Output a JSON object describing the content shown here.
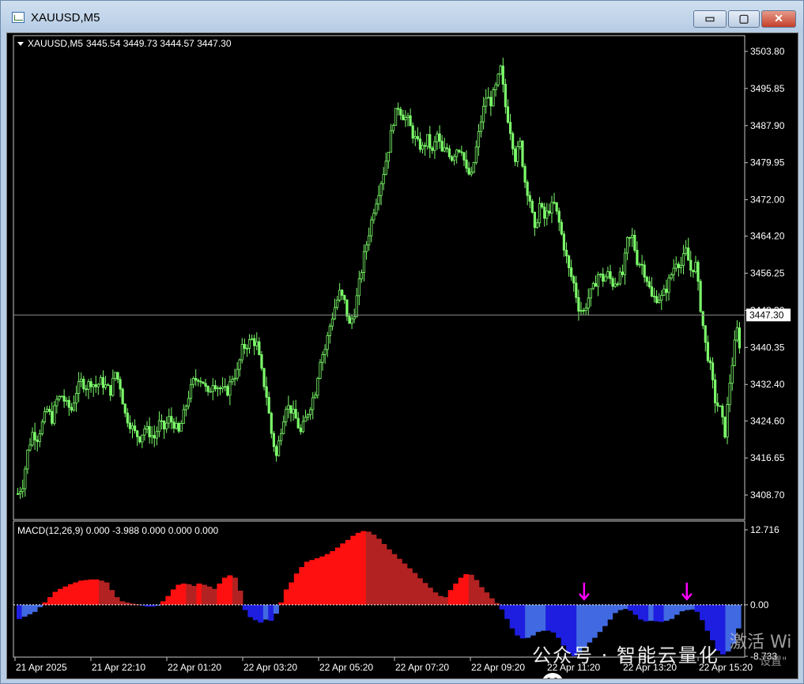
{
  "window": {
    "title": "XAUUSD,M5",
    "buttons": {
      "minimize": "▭",
      "maximize": "▢",
      "close": "✕"
    }
  },
  "price_panel": {
    "header_symbol": "XAUUSD,M5",
    "header_ohlc": "3445.54 3449.73 3444.57 3447.30",
    "y_ticks": [
      "3503.80",
      "3495.85",
      "3487.90",
      "3479.95",
      "3472.00",
      "3464.20",
      "3456.25",
      "3448.30",
      "3440.35",
      "3432.40",
      "3424.60",
      "3416.65",
      "3408.70"
    ],
    "current_price_label": "3447.30",
    "current_price": 3447.3
  },
  "macd_panel": {
    "header": "MACD(12,26,9) 0.000 -3.988 0.000 0.000 0.000",
    "y_ticks": [
      "12.716",
      "0.00",
      "-8.733"
    ]
  },
  "x_ticks": [
    "21 Apr 2025",
    "21 Apr 22:10",
    "22 Apr 01:20",
    "22 Apr 03:20",
    "22 Apr 05:20",
    "22 Apr 07:20",
    "22 Apr 09:20",
    "22 Apr 11:20",
    "22 Apr 13:20",
    "22 Apr 15:20"
  ],
  "overlay": {
    "watermark": "公众号 · 智能云量化",
    "activate": "激活 Wi",
    "activate_sub": "设置\""
  },
  "colors": {
    "candle": "#7cfc6a",
    "macd_red": "#ff1010",
    "macd_darkred": "#b22222",
    "macd_blue": "#1e1ee0",
    "macd_lightblue": "#4169e1",
    "arrow": "#ff00ff",
    "bg": "#000000"
  },
  "chart_data": {
    "type": "candlestick",
    "symbol": "XAUUSD",
    "timeframe": "M5",
    "x_labels": [
      "21 Apr 2025",
      "21 Apr 22:10",
      "22 Apr 01:20",
      "22 Apr 03:20",
      "22 Apr 05:20",
      "22 Apr 07:20",
      "22 Apr 09:20",
      "22 Apr 11:20",
      "22 Apr 13:20",
      "22 Apr 15:20"
    ],
    "ylim": [
      3406.0,
      3506.0
    ],
    "close_path": [
      3409,
      3411,
      3418,
      3422,
      3421,
      3424,
      3427,
      3425,
      3429,
      3430,
      3428,
      3427,
      3431,
      3433,
      3432,
      3433,
      3432,
      3433,
      3432,
      3431,
      3435,
      3432,
      3426,
      3424,
      3422,
      3421,
      3423,
      3422,
      3421,
      3424,
      3423,
      3425,
      3424,
      3422,
      3426,
      3430,
      3433,
      3434,
      3433,
      3430,
      3433,
      3432,
      3431,
      3431,
      3434,
      3435,
      3440,
      3441,
      3442,
      3441,
      3435,
      3430,
      3422,
      3417,
      3423,
      3428,
      3427,
      3425,
      3422,
      3425,
      3428,
      3431,
      3438,
      3440,
      3445,
      3449,
      3452,
      3450,
      3445,
      3448,
      3454,
      3460,
      3465,
      3470,
      3474,
      3478,
      3483,
      3489,
      3492,
      3490,
      3489,
      3486,
      3484,
      3483,
      3485,
      3482,
      3486,
      3482,
      3483,
      3481,
      3483,
      3483,
      3478,
      3477,
      3483,
      3489,
      3494,
      3493,
      3496,
      3500,
      3492,
      3487,
      3481,
      3484,
      3476,
      3472,
      3465,
      3471,
      3468,
      3470,
      3471,
      3467,
      3462,
      3457,
      3454,
      3449,
      3448,
      3451,
      3453,
      3456,
      3455,
      3456,
      3454,
      3455,
      3456,
      3463,
      3464,
      3459,
      3458,
      3455,
      3451,
      3451,
      3451,
      3453,
      3456,
      3459,
      3458,
      3461,
      3457,
      3458,
      3449,
      3441,
      3436,
      3429,
      3427,
      3422,
      3433,
      3441,
      3447
    ],
    "last_close": 3447.3,
    "indicator": {
      "name": "MACD(12,26,9)",
      "values": {
        "main": 0.0,
        "signal": -3.988
      },
      "ylim": [
        -8.733,
        12.716
      ],
      "histogram": [
        -2.4,
        -2.0,
        -1.6,
        -1.2,
        -0.4,
        0.4,
        1.3,
        2.2,
        2.7,
        3.1,
        3.5,
        3.8,
        4.1,
        4.2,
        4.3,
        4.3,
        4.1,
        3.8,
        2.5,
        1.3,
        0.6,
        0.4,
        0.2,
        0.1,
        -0.1,
        -0.3,
        -0.3,
        -0.1,
        0.6,
        1.5,
        2.6,
        3.4,
        3.6,
        3.5,
        3.2,
        3.6,
        3.4,
        3.1,
        2.7,
        3.6,
        4.6,
        5.0,
        4.6,
        2.4,
        -0.9,
        -2.1,
        -2.6,
        -3.0,
        -2.5,
        -2.7,
        -1.5,
        0.4,
        2.6,
        3.8,
        5.3,
        6.4,
        7.3,
        7.6,
        7.9,
        8.2,
        8.6,
        9.1,
        9.7,
        10.4,
        11.0,
        11.7,
        12.2,
        12.5,
        12.4,
        11.9,
        11.2,
        10.3,
        9.4,
        8.6,
        7.8,
        7.0,
        6.2,
        5.4,
        4.5,
        3.7,
        2.9,
        2.1,
        1.5,
        1.3,
        2.5,
        3.6,
        4.6,
        5.2,
        5.1,
        4.2,
        3.0,
        2.1,
        1.1,
        0.3,
        -0.8,
        -2.4,
        -4.0,
        -5.2,
        -5.7,
        -5.6,
        -5.2,
        -4.6,
        -4.4,
        -4.4,
        -4.7,
        -5.6,
        -6.9,
        -8.2,
        -8.7,
        -8.1,
        -7.3,
        -6.4,
        -5.6,
        -4.6,
        -3.6,
        -2.5,
        -1.4,
        -0.9,
        -0.7,
        -1.0,
        -1.7,
        -2.5,
        -2.8,
        -2.7,
        -2.8,
        -2.9,
        -2.7,
        -2.4,
        -1.7,
        -1.1,
        -0.9,
        -0.8,
        -1.2,
        -2.6,
        -4.4,
        -6.0,
        -7.8,
        -8.4,
        -7.9,
        -6.6,
        -4.0
      ],
      "signal_arrows_at_bar": [
        110,
        130
      ]
    }
  }
}
